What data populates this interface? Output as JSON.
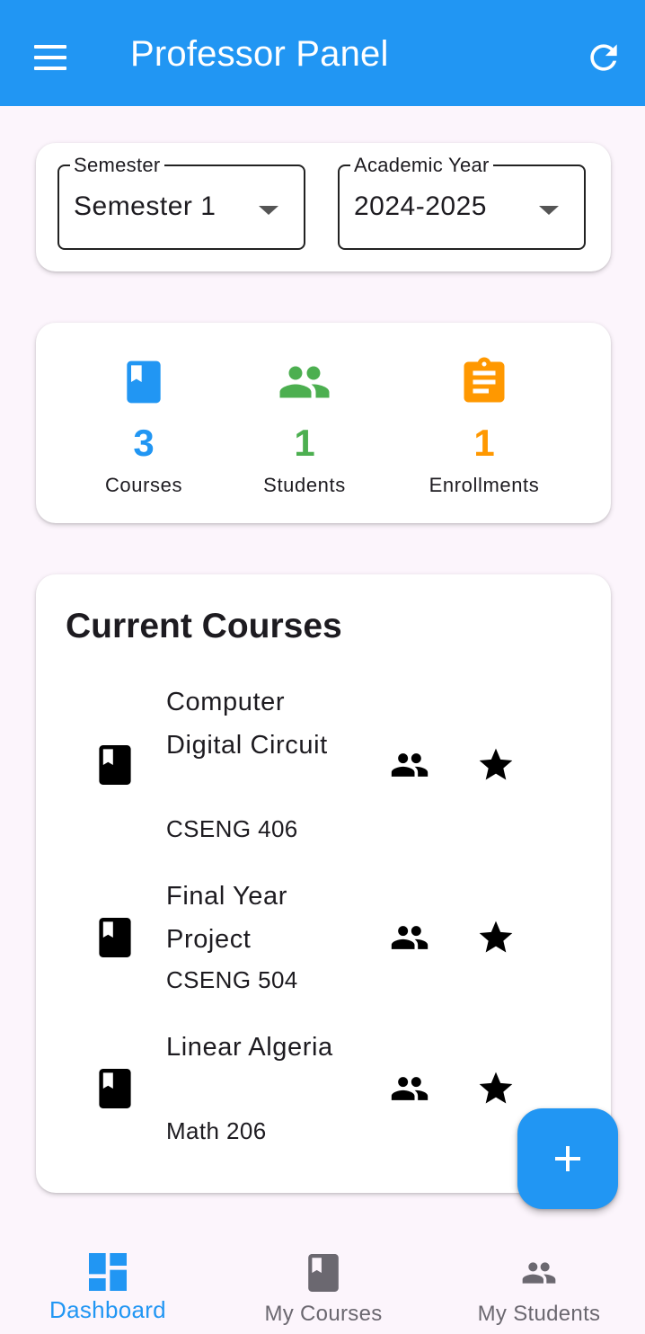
{
  "app": {
    "title": "Professor Panel"
  },
  "header": {
    "menu_icon": "menu-icon",
    "refresh_icon": "refresh-icon"
  },
  "filters": {
    "semester": {
      "label": "Semester",
      "value": "Semester 1"
    },
    "academic_year": {
      "label": "Academic Year",
      "value": "2024-2025"
    }
  },
  "stats": [
    {
      "icon": "book-icon",
      "value": "3",
      "label": "Courses",
      "color": "#2196F3"
    },
    {
      "icon": "people-icon",
      "value": "1",
      "label": "Students",
      "color": "#4CAF50"
    },
    {
      "icon": "assignment-icon",
      "value": "1",
      "label": "Enrollments",
      "color": "#FF9800"
    }
  ],
  "courses_section": {
    "title": "Current Courses",
    "items": [
      {
        "title": "Computer Digital Circuit",
        "code": "CSENG 406"
      },
      {
        "title": "Final Year Project",
        "code": "CSENG 504"
      },
      {
        "title": "Linear Algeria",
        "code": "Math 206"
      }
    ]
  },
  "fab": {
    "icon": "add-icon"
  },
  "bottom_nav": {
    "items": [
      {
        "label": "Dashboard",
        "icon": "dashboard-icon",
        "active": true
      },
      {
        "label": "My Courses",
        "icon": "book-icon",
        "active": false
      },
      {
        "label": "My Students",
        "icon": "people-icon",
        "active": false
      }
    ],
    "active_color": "#2196F3",
    "inactive_color": "#6B6870"
  },
  "colors": {
    "primary": "#2196F3",
    "background": "#FCF5FC"
  }
}
